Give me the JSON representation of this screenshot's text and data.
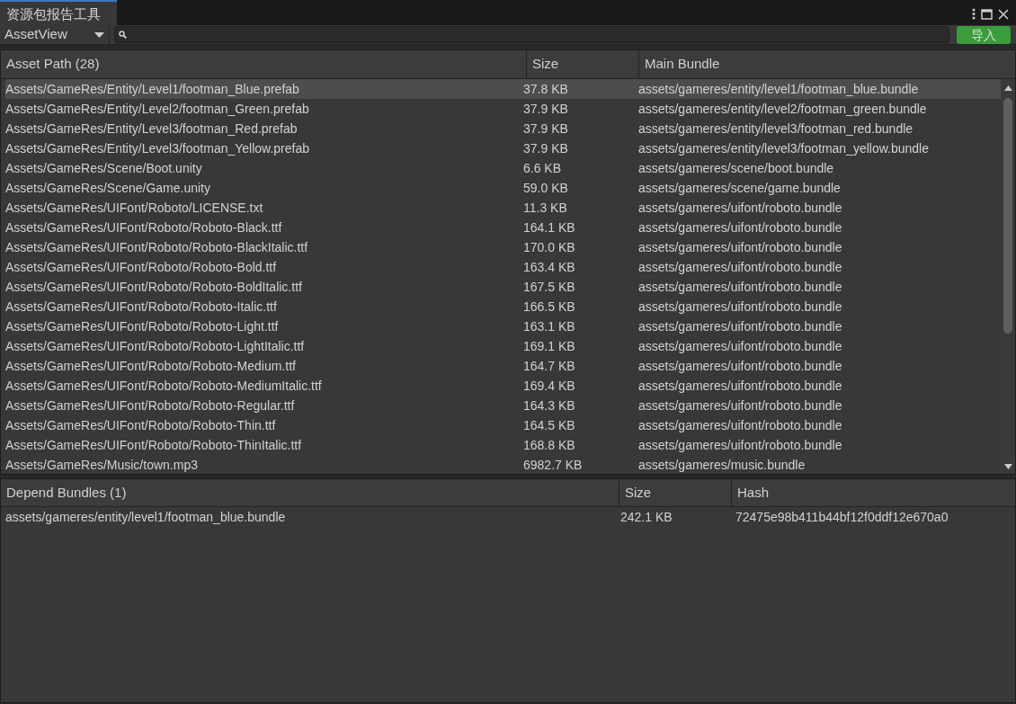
{
  "window": {
    "tab_title": "资源包报告工具"
  },
  "toolbar": {
    "view_dropdown": "AssetView",
    "import_button": "导入"
  },
  "asset_table": {
    "columns": [
      "Asset Path (28)",
      "Size",
      "Main Bundle"
    ],
    "rows": [
      {
        "path": "Assets/GameRes/Entity/Level1/footman_Blue.prefab",
        "size": "37.8 KB",
        "bundle": "assets/gameres/entity/level1/footman_blue.bundle",
        "selected": true
      },
      {
        "path": "Assets/GameRes/Entity/Level2/footman_Green.prefab",
        "size": "37.9 KB",
        "bundle": "assets/gameres/entity/level2/footman_green.bundle",
        "selected": false
      },
      {
        "path": "Assets/GameRes/Entity/Level3/footman_Red.prefab",
        "size": "37.9 KB",
        "bundle": "assets/gameres/entity/level3/footman_red.bundle",
        "selected": false
      },
      {
        "path": "Assets/GameRes/Entity/Level3/footman_Yellow.prefab",
        "size": "37.9 KB",
        "bundle": "assets/gameres/entity/level3/footman_yellow.bundle",
        "selected": false
      },
      {
        "path": "Assets/GameRes/Scene/Boot.unity",
        "size": "6.6 KB",
        "bundle": "assets/gameres/scene/boot.bundle",
        "selected": false
      },
      {
        "path": "Assets/GameRes/Scene/Game.unity",
        "size": "59.0 KB",
        "bundle": "assets/gameres/scene/game.bundle",
        "selected": false
      },
      {
        "path": "Assets/GameRes/UIFont/Roboto/LICENSE.txt",
        "size": "11.3 KB",
        "bundle": "assets/gameres/uifont/roboto.bundle",
        "selected": false
      },
      {
        "path": "Assets/GameRes/UIFont/Roboto/Roboto-Black.ttf",
        "size": "164.1 KB",
        "bundle": "assets/gameres/uifont/roboto.bundle",
        "selected": false
      },
      {
        "path": "Assets/GameRes/UIFont/Roboto/Roboto-BlackItalic.ttf",
        "size": "170.0 KB",
        "bundle": "assets/gameres/uifont/roboto.bundle",
        "selected": false
      },
      {
        "path": "Assets/GameRes/UIFont/Roboto/Roboto-Bold.ttf",
        "size": "163.4 KB",
        "bundle": "assets/gameres/uifont/roboto.bundle",
        "selected": false
      },
      {
        "path": "Assets/GameRes/UIFont/Roboto/Roboto-BoldItalic.ttf",
        "size": "167.5 KB",
        "bundle": "assets/gameres/uifont/roboto.bundle",
        "selected": false
      },
      {
        "path": "Assets/GameRes/UIFont/Roboto/Roboto-Italic.ttf",
        "size": "166.5 KB",
        "bundle": "assets/gameres/uifont/roboto.bundle",
        "selected": false
      },
      {
        "path": "Assets/GameRes/UIFont/Roboto/Roboto-Light.ttf",
        "size": "163.1 KB",
        "bundle": "assets/gameres/uifont/roboto.bundle",
        "selected": false
      },
      {
        "path": "Assets/GameRes/UIFont/Roboto/Roboto-LightItalic.ttf",
        "size": "169.1 KB",
        "bundle": "assets/gameres/uifont/roboto.bundle",
        "selected": false
      },
      {
        "path": "Assets/GameRes/UIFont/Roboto/Roboto-Medium.ttf",
        "size": "164.7 KB",
        "bundle": "assets/gameres/uifont/roboto.bundle",
        "selected": false
      },
      {
        "path": "Assets/GameRes/UIFont/Roboto/Roboto-MediumItalic.ttf",
        "size": "169.4 KB",
        "bundle": "assets/gameres/uifont/roboto.bundle",
        "selected": false
      },
      {
        "path": "Assets/GameRes/UIFont/Roboto/Roboto-Regular.ttf",
        "size": "164.3 KB",
        "bundle": "assets/gameres/uifont/roboto.bundle",
        "selected": false
      },
      {
        "path": "Assets/GameRes/UIFont/Roboto/Roboto-Thin.ttf",
        "size": "164.5 KB",
        "bundle": "assets/gameres/uifont/roboto.bundle",
        "selected": false
      },
      {
        "path": "Assets/GameRes/UIFont/Roboto/Roboto-ThinItalic.ttf",
        "size": "168.8 KB",
        "bundle": "assets/gameres/uifont/roboto.bundle",
        "selected": false
      },
      {
        "path": "Assets/GameRes/Music/town.mp3",
        "size": "6982.7 KB",
        "bundle": "assets/gameres/music.bundle",
        "selected": false
      }
    ]
  },
  "depend_table": {
    "columns": [
      "Depend Bundles (1)",
      "Size",
      "Hash"
    ],
    "rows": [
      {
        "bundle": "assets/gameres/entity/level1/footman_blue.bundle",
        "size": "242.1 KB",
        "hash": "72475e98b411b44bf12f0ddf12e670a0"
      }
    ]
  }
}
